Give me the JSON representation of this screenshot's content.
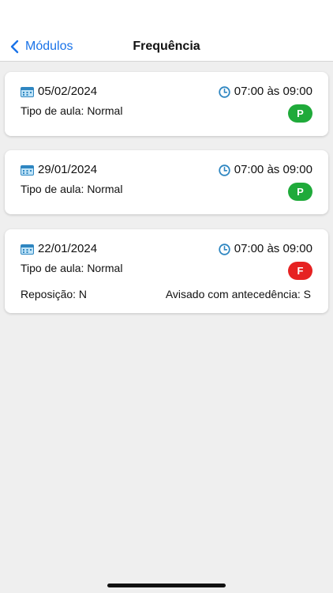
{
  "nav": {
    "back_label": "Módulos",
    "title": "Frequência"
  },
  "colors": {
    "accent": "#1a73e8",
    "present": "#1faa3a",
    "absent": "#e62222",
    "icon": "#2e86c1"
  },
  "records": [
    {
      "date": "05/02/2024",
      "time": "07:00 às 09:00",
      "class_type": "Tipo de aula: Normal",
      "status": "P"
    },
    {
      "date": "29/01/2024",
      "time": "07:00 às 09:00",
      "class_type": "Tipo de aula: Normal",
      "status": "P"
    },
    {
      "date": "22/01/2024",
      "time": "07:00 às 09:00",
      "class_type": "Tipo de aula: Normal",
      "status": "F",
      "reposicao": "Reposição: N",
      "avisado": "Avisado com antecedência: S"
    }
  ]
}
